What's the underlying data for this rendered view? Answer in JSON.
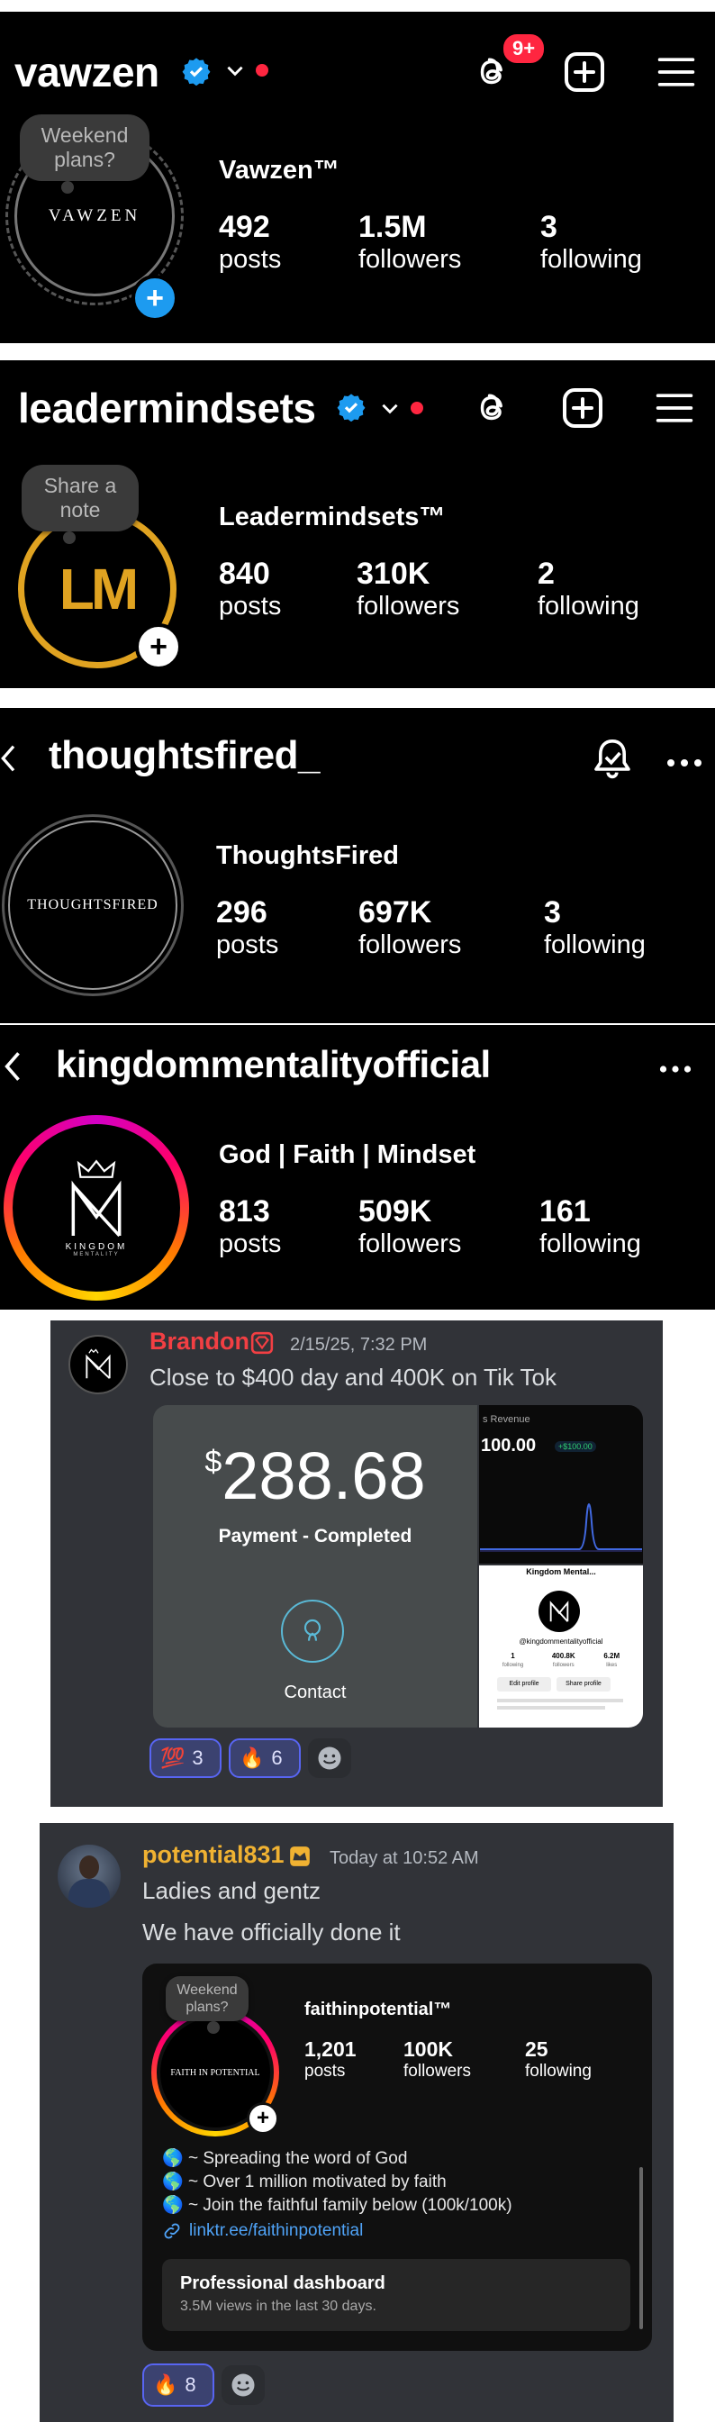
{
  "panel1": {
    "handle": "vawzen",
    "badge_count": "9+",
    "note": "Weekend plans?",
    "avatar_text": "VAWZEN",
    "display_name": "Vawzen™",
    "stats": [
      {
        "num": "492",
        "label": "posts"
      },
      {
        "num": "1.5M",
        "label": "followers"
      },
      {
        "num": "3",
        "label": "following"
      }
    ]
  },
  "panel2": {
    "handle": "leadermindsets",
    "note": "Share a note",
    "avatar_text": "LM",
    "display_name": "Leadermindsets™",
    "stats": [
      {
        "num": "840",
        "label": "posts"
      },
      {
        "num": "310K",
        "label": "followers"
      },
      {
        "num": "2",
        "label": "following"
      }
    ]
  },
  "panel3": {
    "handle": "thoughtsfired_",
    "avatar_text": "THOUGHTSFIRED",
    "display_name": "ThoughtsFired",
    "stats": [
      {
        "num": "296",
        "label": "posts"
      },
      {
        "num": "697K",
        "label": "followers"
      },
      {
        "num": "3",
        "label": "following"
      }
    ]
  },
  "panel4": {
    "handle": "kingdommentalityofficial",
    "avatar_text": "KINGDOM",
    "avatar_subtext": "MENTALITY",
    "display_name": "God | Faith | Mindset",
    "stats": [
      {
        "num": "813",
        "label": "posts"
      },
      {
        "num": "509K",
        "label": "followers"
      },
      {
        "num": "161",
        "label": "following"
      }
    ]
  },
  "card1": {
    "user": "Brandon",
    "user_color": "#f23f43",
    "timestamp": "2/15/25, 7:32 PM",
    "message": "Close to $400 day and 400K on Tik Tok",
    "currency": "$",
    "amount": "288.68",
    "payment_status": "Payment - Completed",
    "contact_label": "Contact",
    "revenue_label": "s Revenue",
    "revenue_value": "100.00",
    "revenue_delta": "+$100.00",
    "mini_name": "Kingdom Mental...",
    "mini_handle": "@kingdommentalityofficial",
    "mini_stats": [
      {
        "num": "1",
        "label": "following"
      },
      {
        "num": "400.8K",
        "label": "followers"
      },
      {
        "num": "6.2M",
        "label": "likes"
      }
    ],
    "mini_edit": "Edit profile",
    "mini_share": "Share profile",
    "reactions": [
      {
        "emoji": "💯",
        "count": "3"
      },
      {
        "emoji": "🔥",
        "count": "6"
      }
    ]
  },
  "card2": {
    "user": "potential831",
    "user_color": "#f0b232",
    "timestamp": "Today at 10:52 AM",
    "messages": [
      "Ladies and gentz",
      "We have officially done it"
    ],
    "embed": {
      "note": "Weekend plans?",
      "avatar_text": "FAITH IN POTENTIAL",
      "display_name": "faithinpotential™",
      "stats": [
        {
          "num": "1,201",
          "label": "posts"
        },
        {
          "num": "100K",
          "label": "followers"
        },
        {
          "num": "25",
          "label": "following"
        }
      ],
      "bio": [
        "~ Spreading the word of God",
        "~ Over 1 million motivated by faith",
        "~ Join the faithful family below (100k/100k)"
      ],
      "link": "linktr.ee/faithinpotential",
      "dashboard_title": "Professional dashboard",
      "dashboard_sub": "3.5M views in the last 30 days."
    },
    "reactions": [
      {
        "emoji": "🔥",
        "count": "8"
      }
    ]
  },
  "colors": {
    "verified_blue": "#1d9bf0",
    "notification_red": "#ff2640",
    "gold": "#e0a321",
    "link_blue": "#4fa3f7"
  }
}
